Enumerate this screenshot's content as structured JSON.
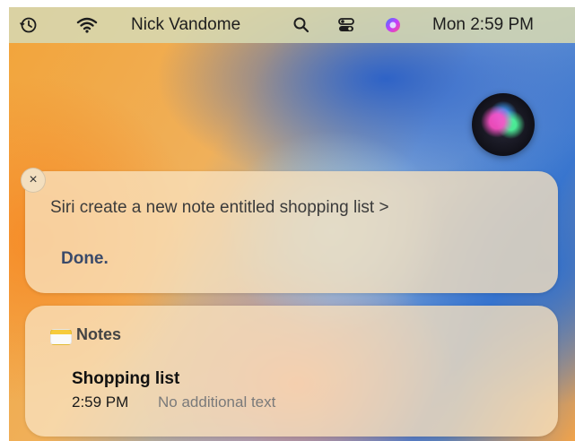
{
  "menubar": {
    "icons": [
      "time-machine-icon",
      "wifi-icon",
      "search-icon",
      "control-center-icon",
      "siri-icon"
    ],
    "user_name": "Nick Vandome",
    "clock": "Mon 2:59 PM"
  },
  "siri": {
    "close_glyph": "×",
    "query": "Siri create a new note entitled shopping list >",
    "response": "Done."
  },
  "note_card": {
    "app_name": "Notes",
    "icon": "notes-icon",
    "note_title": "Shopping list",
    "note_time": "2:59 PM",
    "note_preview": "No additional text"
  },
  "colors": {
    "menubar_bg": "#d6d8b2",
    "card_bg": "#f8e2be",
    "done_text": "#3a4a6a"
  }
}
